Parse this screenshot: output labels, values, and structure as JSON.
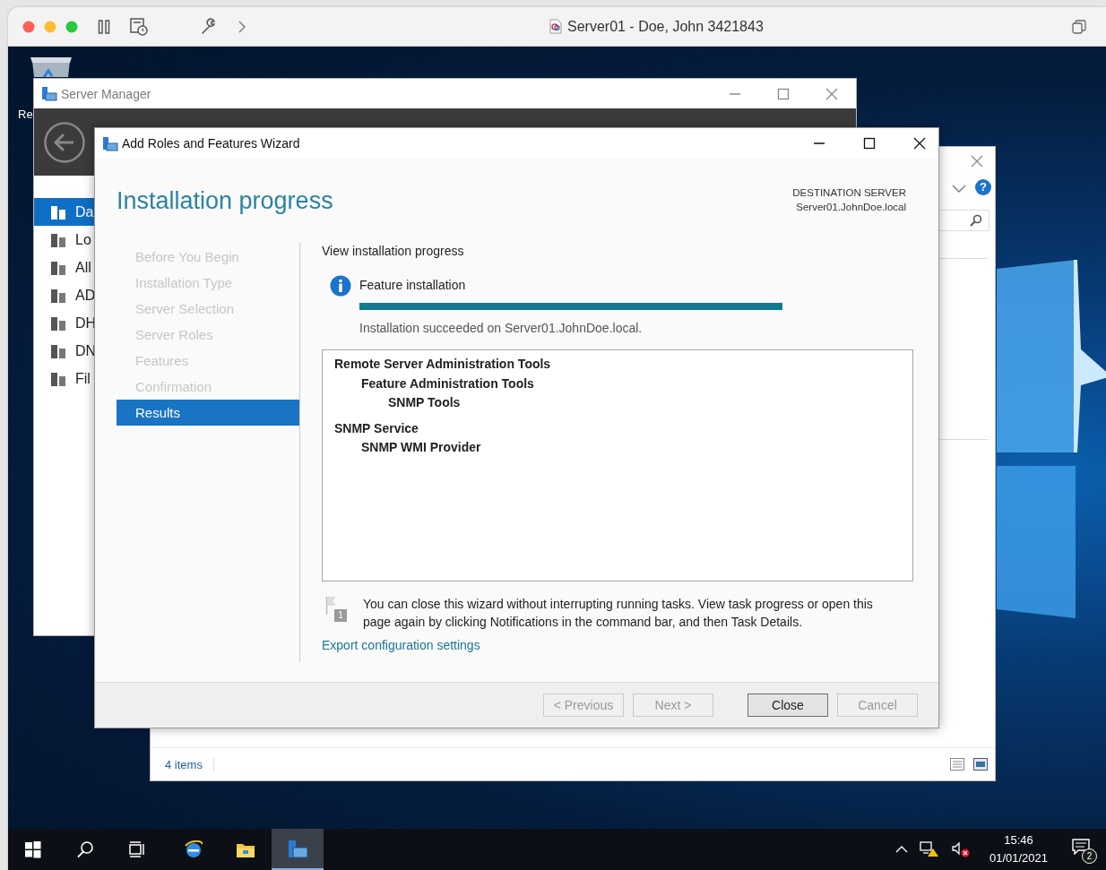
{
  "host_window": {
    "title": "Server01 - Doe, John 3421843"
  },
  "desktop": {
    "icons": [
      {
        "label": "Re"
      }
    ]
  },
  "server_manager": {
    "title": "Server Manager",
    "nav_items": [
      {
        "label": "Da",
        "selected": true
      },
      {
        "label": "Lo",
        "selected": false
      },
      {
        "label": "All",
        "selected": false
      },
      {
        "label": "AD",
        "selected": false
      },
      {
        "label": "DH",
        "selected": false
      },
      {
        "label": "DN",
        "selected": false
      },
      {
        "label": "Fil",
        "selected": false
      }
    ]
  },
  "background_window": {
    "help_glyph": "?",
    "status": "4 items"
  },
  "wizard": {
    "title": "Add Roles and Features Wizard",
    "heading": "Installation progress",
    "destination_label": "DESTINATION SERVER",
    "destination_server": "Server01.JohnDoe.local",
    "steps": [
      {
        "label": "Before You Begin",
        "selected": false
      },
      {
        "label": "Installation Type",
        "selected": false
      },
      {
        "label": "Server Selection",
        "selected": false
      },
      {
        "label": "Server Roles",
        "selected": false
      },
      {
        "label": "Features",
        "selected": false
      },
      {
        "label": "Confirmation",
        "selected": false
      },
      {
        "label": "Results",
        "selected": true
      }
    ],
    "section_title": "View installation progress",
    "task": {
      "label": "Feature installation",
      "level": 1,
      "result": "Installation succeeded on Server01.JohnDoe.local."
    },
    "results": [
      {
        "label": "Remote Server Administration Tools",
        "children": [
          {
            "label": "Feature Administration Tools",
            "children": [
              {
                "label": "SNMP Tools"
              }
            ]
          }
        ]
      },
      {
        "label": "SNMP Service",
        "children": [
          {
            "label": "SNMP WMI Provider"
          }
        ]
      }
    ],
    "note_badge": "1",
    "note": "You can close this wizard without interrupting running tasks. View task progress or open this page again by clicking Notifications in the command bar, and then Task Details.",
    "export_link": "Export configuration settings",
    "buttons": [
      {
        "label": "< Previous",
        "disabled": true,
        "default": false
      },
      {
        "label": "Next >",
        "disabled": true,
        "default": false
      },
      {
        "label": "Close",
        "disabled": false,
        "default": true
      },
      {
        "label": "Cancel",
        "disabled": true,
        "default": false
      }
    ]
  },
  "taskbar": {
    "apps": [
      {
        "kind": "start",
        "selected": false
      },
      {
        "kind": "search",
        "selected": false
      },
      {
        "kind": "task-view",
        "selected": false
      },
      {
        "kind": "browser",
        "selected": false
      },
      {
        "kind": "explorer",
        "selected": false
      },
      {
        "kind": "server-manager",
        "selected": true
      }
    ],
    "clock": {
      "time": "15:46",
      "date": "01/01/2021"
    },
    "notification_count": "2"
  }
}
